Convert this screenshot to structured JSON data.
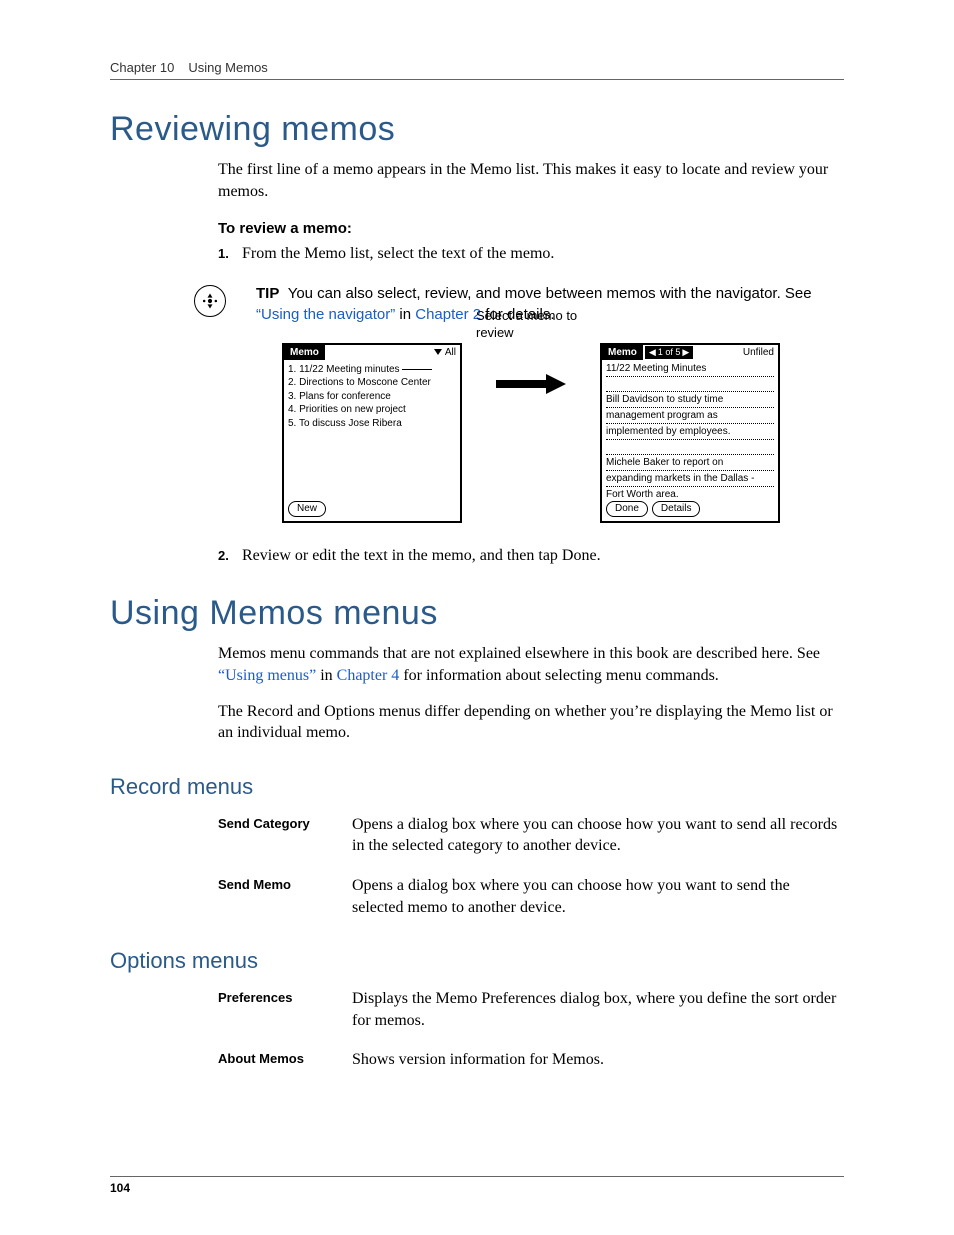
{
  "header": {
    "chapter": "Chapter 10",
    "title": "Using Memos"
  },
  "page_number": "104",
  "h1_reviewing": "Reviewing memos",
  "p_reviewing": "The first line of a memo appears in the Memo list. This makes it easy to locate and review your memos.",
  "proc_title": "To review a memo:",
  "step1_num": "1.",
  "step1_text": "From the Memo list, select the text of the memo.",
  "tip": {
    "label": "TIP",
    "before": "You can also select, review, and move between memos with the navigator. See ",
    "link1": "“Using the navigator”",
    "mid": " in ",
    "link2": "Chapter 2",
    "after": " for details."
  },
  "callout": "Select a memo to review",
  "screen_list": {
    "title": "Memo",
    "dropdown": "All",
    "items": [
      "1.  11/22 Meeting minutes",
      "2.  Directions to Moscone Center",
      "3.  Plans for conference",
      "4.  Priorities on new project",
      "5.  To discuss Jose Ribera"
    ],
    "new_btn": "New"
  },
  "screen_detail": {
    "title": "Memo",
    "counter": "1 of 5",
    "category": "Unfiled",
    "heading": "11/22 Meeting Minutes",
    "lines": [
      "Bill Davidson to study time",
      "management program as",
      "implemented by employees.",
      "",
      "Michele Baker to report on",
      "expanding markets in the Dallas -",
      "Fort Worth area."
    ],
    "done_btn": "Done",
    "details_btn": "Details"
  },
  "step2_num": "2.",
  "step2_text": "Review or edit the text in the memo, and then tap Done.",
  "h1_menus": "Using Memos menus",
  "p_menus_before": "Memos menu commands that are not explained elsewhere in this book are described here. See ",
  "p_menus_link1": "“Using menus”",
  "p_menus_mid": " in ",
  "p_menus_link2": "Chapter 4",
  "p_menus_after": " for information about selecting menu commands.",
  "p_menus_2": "The Record and Options menus differ depending on whether you’re displaying the Memo list or an individual memo.",
  "h2_record": "Record menus",
  "record_rows": {
    "r0_term": "Send Category",
    "r0_desc": "Opens a dialog box where you can choose how you want to send all records in the selected category to another device.",
    "r1_term": "Send Memo",
    "r1_desc": "Opens a dialog box where you can choose how you want to send the selected memo to another device."
  },
  "h2_options": "Options menus",
  "options_rows": {
    "r0_term": "Preferences",
    "r0_desc": "Displays the Memo Preferences dialog box, where you define the sort order for memos.",
    "r1_term": "About Memos",
    "r1_desc": "Shows version information for Memos."
  }
}
